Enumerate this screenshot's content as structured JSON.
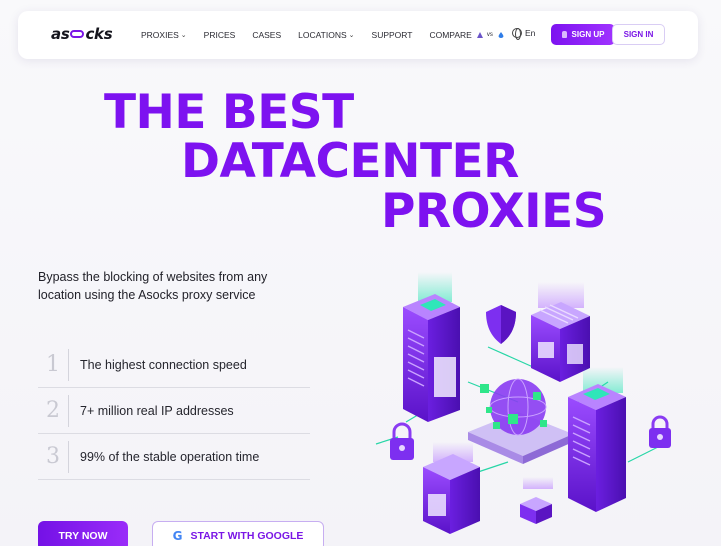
{
  "brand": {
    "logo_left": "as",
    "logo_right": "cks",
    "accent": "#7d12f0"
  },
  "nav": {
    "items": [
      {
        "label": "PROXIES",
        "dropdown": true
      },
      {
        "label": "PRICES",
        "dropdown": false
      },
      {
        "label": "CASES",
        "dropdown": false
      },
      {
        "label": "LOCATIONS",
        "dropdown": true
      },
      {
        "label": "SUPPORT",
        "dropdown": false
      },
      {
        "label": "COMPARE",
        "dropdown": false,
        "suffix": "vs"
      }
    ],
    "language": "En",
    "sign_up": "SIGN UP",
    "sign_in": "SIGN IN"
  },
  "hero": {
    "title_line1": "THE BEST",
    "title_line2": "DATACENTER",
    "title_line3": "PROXIES",
    "subtitle": "Bypass the blocking of websites from any location using the Asocks proxy service",
    "features": [
      {
        "num": "1",
        "text": "The highest connection speed"
      },
      {
        "num": "2",
        "text": "7+ million real IP addresses"
      },
      {
        "num": "3",
        "text": "99% of the stable operation time"
      }
    ],
    "try_now": "TRY NOW",
    "google": "START WITH GOOGLE"
  },
  "icons": {
    "nav_chevron": "chevron-down-icon",
    "language": "globe-icon",
    "sign_up": "user-icon",
    "google": "google-icon",
    "illustration": "server-network-illustration"
  }
}
